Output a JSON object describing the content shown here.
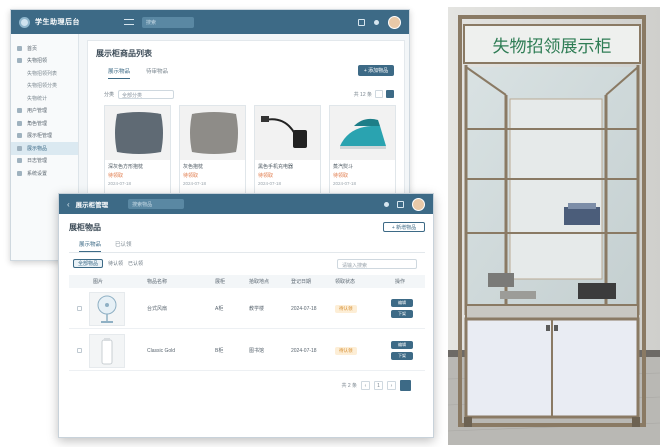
{
  "back_window": {
    "app_title": "学生助理后台",
    "search_placeholder": "搜索",
    "sidebar": [
      {
        "label": "首页",
        "sub": false,
        "active": false
      },
      {
        "label": "失物招领",
        "sub": false,
        "active": false
      },
      {
        "label": "失物招领列表",
        "sub": true,
        "active": false
      },
      {
        "label": "失物招领分类",
        "sub": true,
        "active": false
      },
      {
        "label": "失物统计",
        "sub": true,
        "active": false
      },
      {
        "label": "用户管理",
        "sub": false,
        "active": false
      },
      {
        "label": "角色管理",
        "sub": false,
        "active": false
      },
      {
        "label": "展示柜管理",
        "sub": false,
        "active": false
      },
      {
        "label": "展示物品",
        "sub": false,
        "active": true
      },
      {
        "label": "日志管理",
        "sub": false,
        "active": false
      },
      {
        "label": "系统设置",
        "sub": false,
        "active": false
      }
    ],
    "page_title": "展示柜商品列表",
    "tabs": [
      "展示物品",
      "待审物品"
    ],
    "add_button": "+ 添加物品",
    "filter_label": "分类",
    "filter_value": "全部分类",
    "pager_label": "共 12 条",
    "products": [
      {
        "name": "深灰色方形抱枕",
        "price": "待领取",
        "meta": "2024-07-18",
        "kind": "pillow-dark"
      },
      {
        "name": "灰色抱枕",
        "price": "待领取",
        "meta": "2024-07-18",
        "kind": "pillow-gray"
      },
      {
        "name": "黑色手机充电器",
        "price": "待领取",
        "meta": "2024-07-18",
        "kind": "charger"
      },
      {
        "name": "蒸汽熨斗",
        "price": "待领取",
        "meta": "2024-07-18",
        "kind": "iron"
      }
    ]
  },
  "front_window": {
    "app_title": "展示柜管理",
    "search_placeholder": "搜索物品",
    "page_title": "展柜物品",
    "export_button": "+ 新增物品",
    "tabs": [
      "展示物品",
      "已认领"
    ],
    "filter_chips": [
      "全部物品",
      "待认领",
      "已认领"
    ],
    "search_placeholder_table": "请输入搜索",
    "columns": [
      "图片",
      "物品名称",
      "展柜",
      "拾取地点",
      "登记日期",
      "领取状态",
      "操作"
    ],
    "rows": [
      {
        "name": "台式风扇",
        "cabinet": "A柜",
        "location": "教学楼",
        "date": "2024-07-18",
        "status": "待认领",
        "kind": "fan"
      },
      {
        "name": "Classic Gold",
        "cabinet": "B柜",
        "location": "图书馆",
        "date": "2024-07-18",
        "status": "待认领",
        "kind": "bottle"
      }
    ],
    "row_actions": [
      "编辑",
      "下架"
    ],
    "pager_total": "共 2 条",
    "pager_page": "1"
  },
  "photo": {
    "sign_text": "失物招领展示柜"
  },
  "colors": {
    "primary": "#3d6a86",
    "accent_orange": "#e07a4a",
    "badge_bg": "#fdeed6",
    "cabinet_frame": "#8a7a64"
  }
}
